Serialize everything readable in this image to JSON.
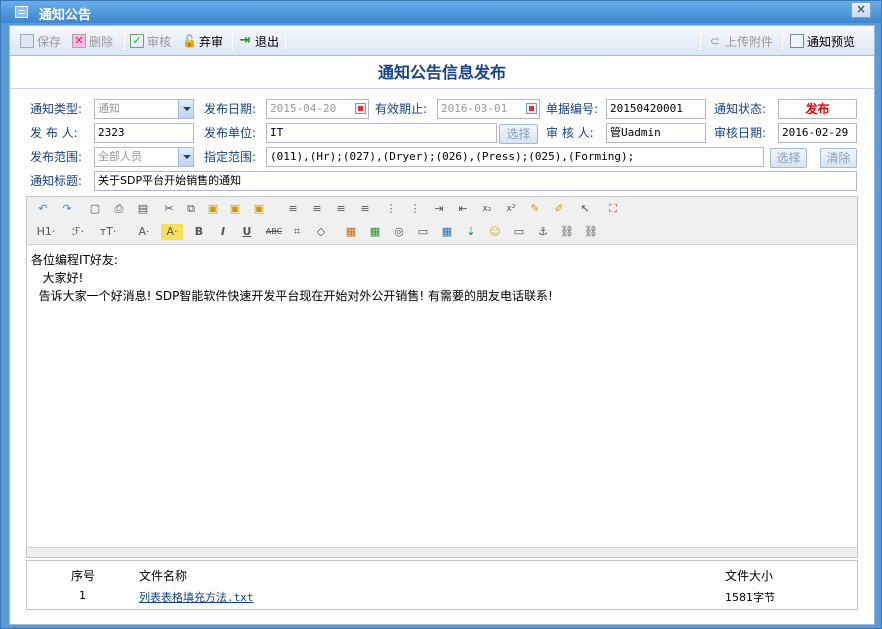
{
  "window": {
    "title": "通知公告"
  },
  "toolbar": {
    "save": "保存",
    "delete": "删除",
    "review": "审核",
    "abandon": "弃审",
    "exit": "退出",
    "upload": "上传附件",
    "preview": "通知预览"
  },
  "form": {
    "title": "通知公告信息发布",
    "type_label": "通知类型:",
    "type_value": "通知",
    "publish_date_label": "发布日期:",
    "publish_date_value": "2015-04-20",
    "valid_until_label": "有效期止:",
    "valid_until_value": "2016-03-01",
    "doc_no_label": "单据编号:",
    "doc_no_value": "20150420001",
    "status_label": "通知状态:",
    "status_value": "发布",
    "publisher_label": "发 布 人:",
    "publisher_value": "2323",
    "publish_unit_label": "发布单位:",
    "publish_unit_value": "IT",
    "select_label": "选择",
    "reviewer_label": "审 核 人:",
    "reviewer_value": "管Uadmin",
    "review_date_label": "审核日期:",
    "review_date_value": "2016-02-29",
    "scope_label": "发布范围:",
    "scope_value": "全部人员",
    "assigned_scope_label": "指定范围:",
    "assigned_scope_value": "(011),(Hr);(027),(Dryer);(026),(Press);(025),(Forming);",
    "select2_label": "选择",
    "clear_label": "清除",
    "subject_label": "通知标题:",
    "subject_value": "关于SDP平台开始销售的通知"
  },
  "editor": {
    "toolbar_row2": {
      "h1": "H1·",
      "font": "ℱ·",
      "size": "тT·",
      "fontcolor": "A·",
      "highlight": "A·",
      "bold": "B",
      "italic": "I",
      "underline": "U",
      "strike": "ABC"
    },
    "content": [
      "各位编程IT好友:",
      "   大家好!",
      "  告诉大家一个好消息! SDP智能软件快速开发平台现在开始对外公开销售! 有需要的朋友电话联系!"
    ]
  },
  "attachments": {
    "headers": {
      "no": "序号",
      "name": "文件名称",
      "size": "文件大小"
    },
    "rows": [
      {
        "no": "1",
        "name": "列表表格填充方法.txt",
        "size": "1581字节"
      }
    ]
  },
  "colors": {
    "accent": "#15428b",
    "status": "#ee0000",
    "titlebar": "#3d86cf"
  }
}
